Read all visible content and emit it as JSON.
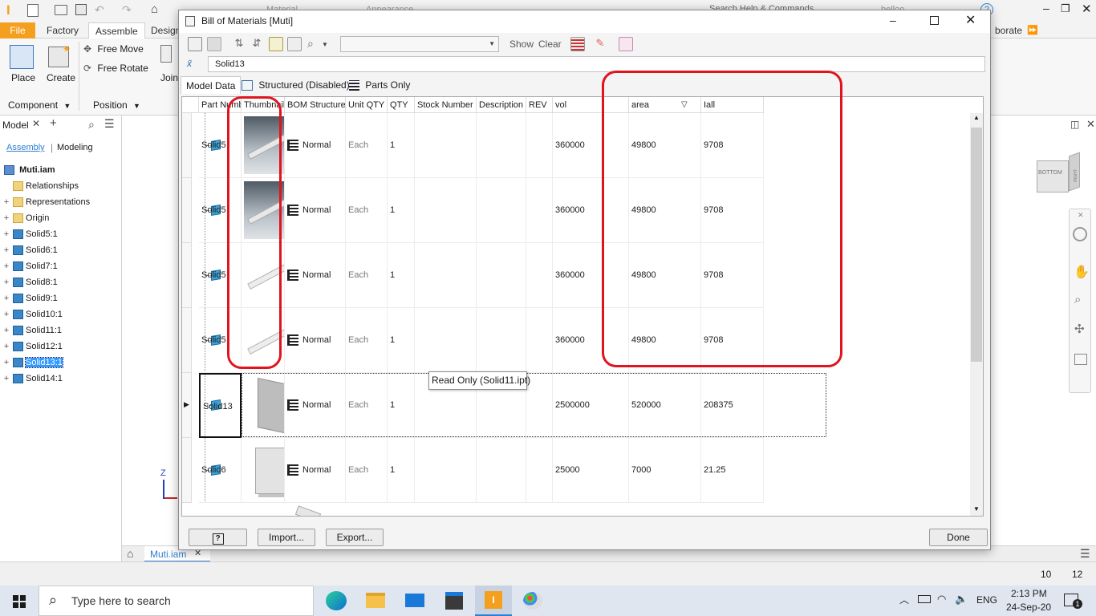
{
  "app": {
    "quick_access_title": "Material",
    "appearance_label": "Appearance",
    "search_commands": "Search Help & Commands...",
    "user": "belloo"
  },
  "ribbon": {
    "tabs": [
      "File",
      "Factory",
      "Assemble",
      "Design"
    ],
    "right_tab": "borate",
    "groups": {
      "component": {
        "label": "Component",
        "place": "Place",
        "create": "Create"
      },
      "position": {
        "label": "Position",
        "free_move": "Free Move",
        "free_rotate": "Free Rotate",
        "join": "Join"
      }
    }
  },
  "browser": {
    "title": "Model",
    "tabs": {
      "assembly": "Assembly",
      "modeling": "Modeling"
    },
    "root": "Muti.iam",
    "items": [
      {
        "label": "Relationships",
        "icon": "folder-icon",
        "expand": ""
      },
      {
        "label": "Representations",
        "icon": "representations-icon",
        "expand": "+"
      },
      {
        "label": "Origin",
        "icon": "folder-icon",
        "expand": "+"
      },
      {
        "label": "Solid5:1",
        "icon": "part-icon",
        "expand": "+"
      },
      {
        "label": "Solid6:1",
        "icon": "part-icon",
        "expand": "+"
      },
      {
        "label": "Solid7:1",
        "icon": "part-icon",
        "expand": "+"
      },
      {
        "label": "Solid8:1",
        "icon": "part-icon",
        "expand": "+"
      },
      {
        "label": "Solid9:1",
        "icon": "part-icon",
        "expand": "+"
      },
      {
        "label": "Solid10:1",
        "icon": "part-icon",
        "expand": "+"
      },
      {
        "label": "Solid11:1",
        "icon": "part-icon",
        "expand": "+"
      },
      {
        "label": "Solid12:1",
        "icon": "part-icon",
        "expand": "+"
      },
      {
        "label": "Solid13:1",
        "icon": "part-icon",
        "expand": "+",
        "selected": true
      },
      {
        "label": "Solid14:1",
        "icon": "part-icon",
        "expand": "+"
      }
    ]
  },
  "viewcube": {
    "face_label": "BOTTOM",
    "side_label": "RIGHT"
  },
  "triad": {
    "z_label": "Z"
  },
  "document_tabs": {
    "active": "Muti.iam"
  },
  "status": {
    "left_count": "10",
    "right_count": "12"
  },
  "dialog": {
    "title": "Bill of Materials [Muti]",
    "filter_value": "Solid13",
    "toolbar": {
      "show_label": "Show",
      "clear_label": "Clear"
    },
    "tabs": [
      "Model Data",
      "Structured (Disabled)",
      "Parts Only"
    ],
    "columns": [
      "Part Number",
      "Thumbnail",
      "BOM Structure",
      "Unit QTY",
      "QTY",
      "Stock Number",
      "Description",
      "REV",
      "vol",
      "area",
      "Iall"
    ],
    "rows": [
      {
        "part_number": "Solid5",
        "bom_structure": "Normal",
        "unit_qty": "Each",
        "qty": "1",
        "stock_number": "",
        "description": "",
        "rev": "",
        "vol": "360000",
        "area": "49800",
        "iall": "9708",
        "thumb": "bar-shaded"
      },
      {
        "part_number": "Solid5",
        "bom_structure": "Normal",
        "unit_qty": "Each",
        "qty": "1",
        "stock_number": "",
        "description": "",
        "rev": "",
        "vol": "360000",
        "area": "49800",
        "iall": "9708",
        "thumb": "bar-shaded"
      },
      {
        "part_number": "Solid5",
        "bom_structure": "Normal",
        "unit_qty": "Each",
        "qty": "1",
        "stock_number": "",
        "description": "",
        "rev": "",
        "vol": "360000",
        "area": "49800",
        "iall": "9708",
        "thumb": "bar-light"
      },
      {
        "part_number": "Solid5",
        "bom_structure": "Normal",
        "unit_qty": "Each",
        "qty": "1",
        "stock_number": "",
        "description": "",
        "rev": "",
        "vol": "360000",
        "area": "49800",
        "iall": "9708",
        "thumb": "bar-light"
      },
      {
        "part_number": "Solid13",
        "bom_structure": "Normal",
        "unit_qty": "Each",
        "qty": "1",
        "stock_number": "",
        "description": "",
        "rev": "",
        "vol": "2500000",
        "area": "520000",
        "iall": "208375",
        "thumb": "plate",
        "selected": true
      },
      {
        "part_number": "Solid6",
        "bom_structure": "Normal",
        "unit_qty": "Each",
        "qty": "1",
        "stock_number": "",
        "description": "",
        "rev": "",
        "vol": "25000",
        "area": "7000",
        "iall": "21.25",
        "thumb": "block"
      }
    ],
    "tooltip": "Read Only (Solid11.ipt)",
    "buttons": {
      "help": "?",
      "import": "Import...",
      "export": "Export...",
      "done": "Done"
    }
  },
  "taskbar": {
    "search_placeholder": "Type here to search",
    "language": "ENG",
    "time": "2:13 PM",
    "date": "24-Sep-20",
    "notification_count": "1"
  },
  "colors": {
    "file_tab": "#f4a01e",
    "highlight": "#e0141f",
    "accent_blue": "#2f7fd1",
    "selection": "#3399ff"
  }
}
